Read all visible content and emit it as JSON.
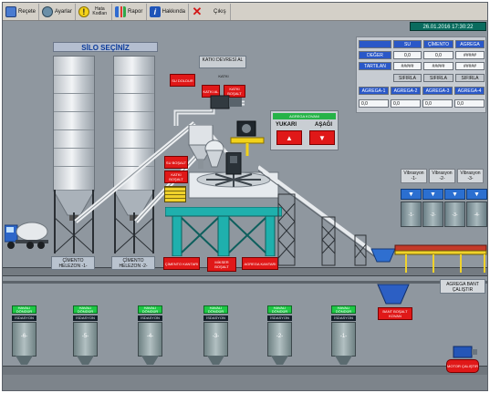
{
  "toolbar": {
    "items": [
      {
        "label": "Reçete",
        "icon": "recipe-icon"
      },
      {
        "label": "Ayarlar",
        "icon": "settings-icon"
      },
      {
        "label": "Hata Kodları",
        "icon": "warning-icon"
      },
      {
        "label": "Rapor",
        "icon": "report-icon"
      },
      {
        "label": "Hakkında",
        "icon": "info-icon"
      },
      {
        "label": "Çıkış",
        "icon": "exit-icon"
      }
    ]
  },
  "datetime": "26.01.2016 17:30:22",
  "silo_title": "SİLO SEÇİNİZ",
  "silo_labels": [
    "ÇİMENTO HELEZON -1-",
    "ÇİMENTO HELEZON -2-"
  ],
  "katkı": {
    "title": "KATKI DEVRESİ AL",
    "su_buttons": [
      "SU DOLDUR"
    ],
    "buttons": [
      "KATKI AL",
      "KATKI BOŞALT"
    ],
    "katki_label": "KATKI"
  },
  "mixer_buttons": [
    "SU BOŞALT",
    "KATKI BOŞALT"
  ],
  "plant_buttons": [
    "ÇİMENTO KANTARI",
    "MİKSER BOŞALT",
    "AGREGA KANTARI"
  ],
  "lift": {
    "title": "AGREGA KOVANI",
    "up_label": "YUKARI",
    "down_label": "AŞAĞI"
  },
  "panel": {
    "headers": [
      "SU",
      "ÇİMENTO",
      "AGREGA"
    ],
    "rows": [
      {
        "label": "DEĞER",
        "values": [
          "0,0",
          "0,0",
          "#####"
        ]
      },
      {
        "label": "TARTILAN",
        "values": [
          "#####",
          "#####",
          "#####"
        ]
      }
    ],
    "sifirla": [
      "SIFIRLA",
      "SIFIRLA",
      "SIFIRLA"
    ],
    "agrega_headers": [
      "AGREGA-1",
      "AGREGA-2",
      "AGREGA-3",
      "AGREGA-4"
    ],
    "agrega_values": [
      "0,0",
      "0,0",
      "0,0",
      "0,0"
    ]
  },
  "vibrasyon": [
    "Vibrasyon -1-",
    "Vibrasyon -2-",
    "Vibrasyon -3-"
  ],
  "agrega_bins": [
    "-1-",
    "-2-",
    "-3-",
    "-4-"
  ],
  "conveyor_label": "AGREGA BANT ÇALIŞTIR",
  "hopper_button": "BANT BOŞALT KOVAN",
  "bottom_bins": [
    {
      "label": "HAVALI DÖNDÜR",
      "name": "İSDASYON",
      "num": "-6-"
    },
    {
      "label": "HAVALI DÖNDÜR",
      "name": "İSDASYON",
      "num": "-5-"
    },
    {
      "label": "HAVALI DÖNDÜR",
      "name": "İSDASYON",
      "num": "-4-"
    },
    {
      "label": "HAVALI DÖNDÜR",
      "name": "İSDASYON",
      "num": "-3-"
    },
    {
      "label": "HAVALI DÖNDÜR",
      "name": "İSDASYON",
      "num": "-2-"
    },
    {
      "label": "HAVALI DÖNDÜR",
      "name": "İSDASYON",
      "num": "-1-"
    }
  ],
  "motor_button": "MOTOR ÇALIŞTIR",
  "colors": {
    "accent_red": "#e01818",
    "accent_green": "#22c84a",
    "accent_blue": "#2a58c8",
    "background": "#8f979f"
  }
}
